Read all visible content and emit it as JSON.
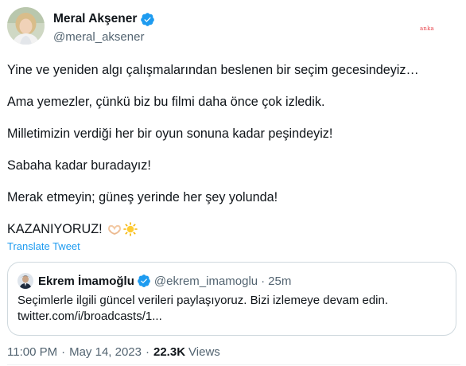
{
  "author": {
    "name": "Meral Akşener",
    "handle": "@meral_aksener",
    "verified": true
  },
  "watermark": "anka",
  "tweet": {
    "paragraphs": [
      "Yine ve yeniden algı çalışmalarından beslenen bir seçim gecesindeyiz…",
      "Ama yemezler, çünkü biz bu filmi daha önce çok izledik.",
      "Milletimizin verdiği her bir oyun sonuna kadar peşindeyiz!",
      "Sabaha kadar buradayız!",
      "Merak etmeyin; güneş yerinde her şey yolunda!",
      "KAZANIYORUZ!"
    ],
    "emojis": [
      "heart-hands",
      "sun"
    ],
    "translate_label": "Translate Tweet"
  },
  "quote": {
    "name": "Ekrem İmamoğlu",
    "verified": true,
    "handle": "@ekrem_imamoglu",
    "separator": "·",
    "time": "25m",
    "text_line1": "Seçimlerle ilgili güncel verileri paylaşıyoruz. Bizi izlemeye devam edin.",
    "text_line2": "twitter.com/i/broadcasts/1..."
  },
  "meta": {
    "time": "11:00 PM",
    "dot1": "·",
    "date": "May 14, 2023",
    "dot2": "·",
    "views_count": "22.3K",
    "views_label": "Views"
  },
  "colors": {
    "accent": "#1d9bf0",
    "secondary_text": "#536471",
    "primary_text": "#0f1419",
    "border": "#cfd9de",
    "watermark": "#e8474f"
  }
}
